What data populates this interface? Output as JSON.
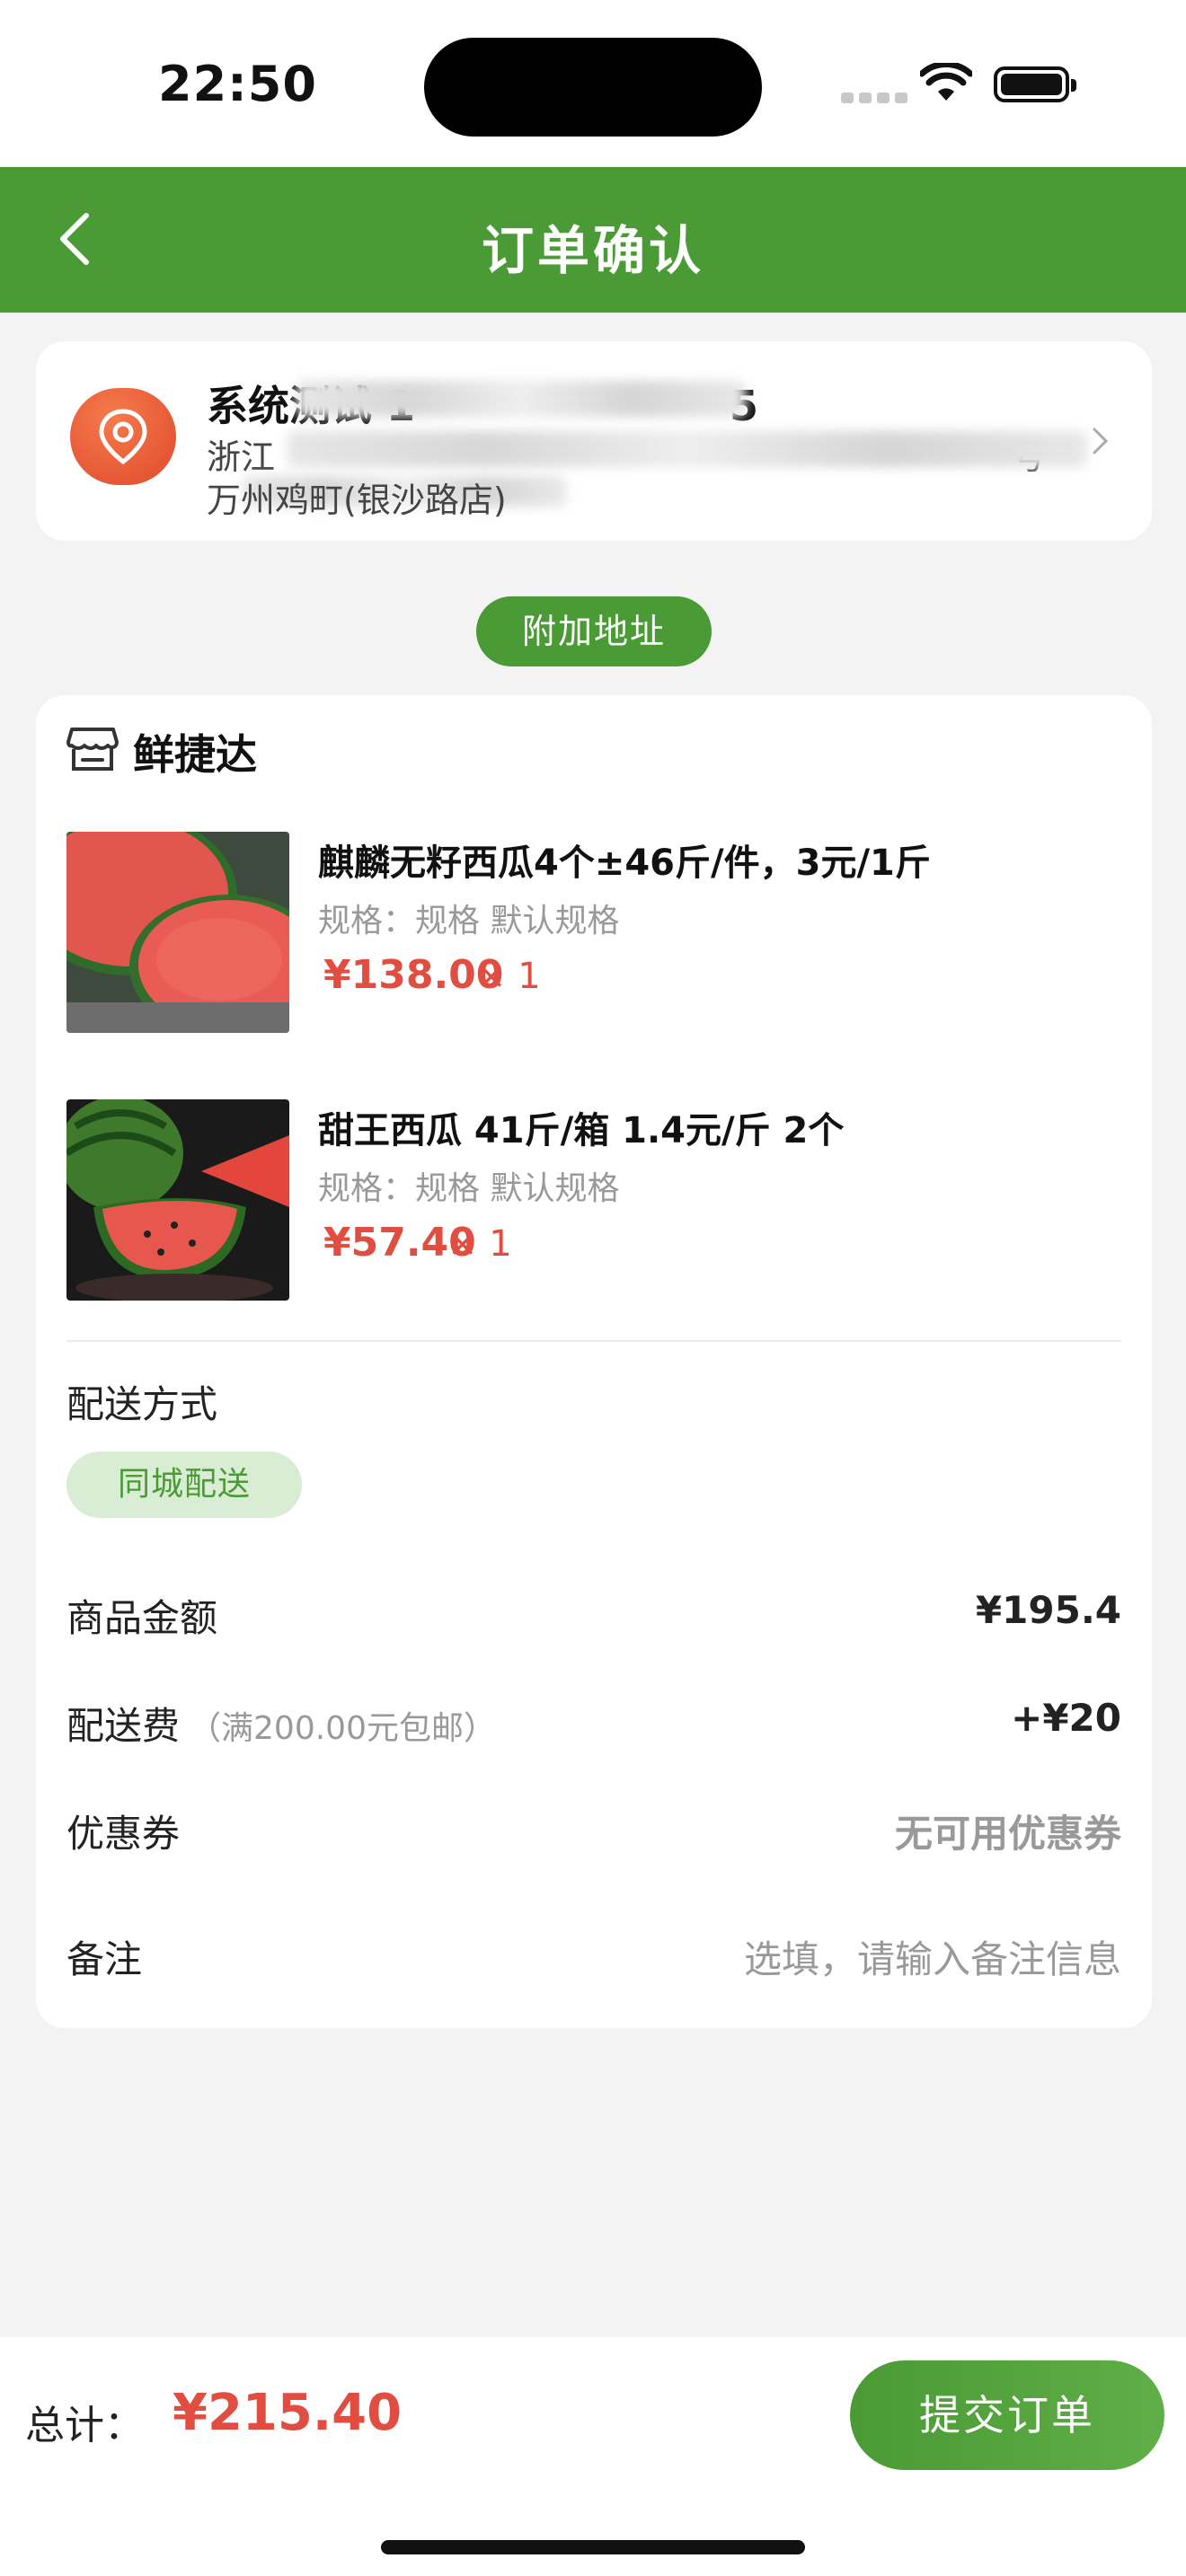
{
  "status_bar": {
    "time": "22:50"
  },
  "nav": {
    "title": "订单确认"
  },
  "address": {
    "name": "系统测试 1",
    "name_tail": "5",
    "line1_start": "浙江",
    "line1_end": "号",
    "line2": "万州鸡町(银沙路店)"
  },
  "add_address_button": "附加地址",
  "store": {
    "name": "鲜捷达"
  },
  "items": [
    {
      "title": "麒麟无籽西瓜4个±46斤/件，3元/1斤",
      "spec": "规格：规格 默认规格",
      "price": "¥138.00",
      "qty": "× 1"
    },
    {
      "title": "甜王西瓜 41斤/箱 1.4元/斤 2个",
      "spec": "规格：规格 默认规格",
      "price": "¥57.40",
      "qty": "× 1"
    }
  ],
  "delivery": {
    "label": "配送方式",
    "option": "同城配送"
  },
  "summary": {
    "goods_label": "商品金额",
    "goods_value": "¥195.4",
    "fee_label": "配送费",
    "fee_hint": "（满200.00元包邮）",
    "fee_value": "+¥20",
    "coupon_label": "优惠券",
    "coupon_value": "无可用优惠券",
    "note_label": "备注",
    "note_placeholder": "选填，请输入备注信息"
  },
  "footer": {
    "total_label": "总计：",
    "total_value": "¥215.40",
    "submit_label": "提交订单"
  },
  "colors": {
    "brand_green": "#4a9a35",
    "price_red": "#e14d40"
  }
}
